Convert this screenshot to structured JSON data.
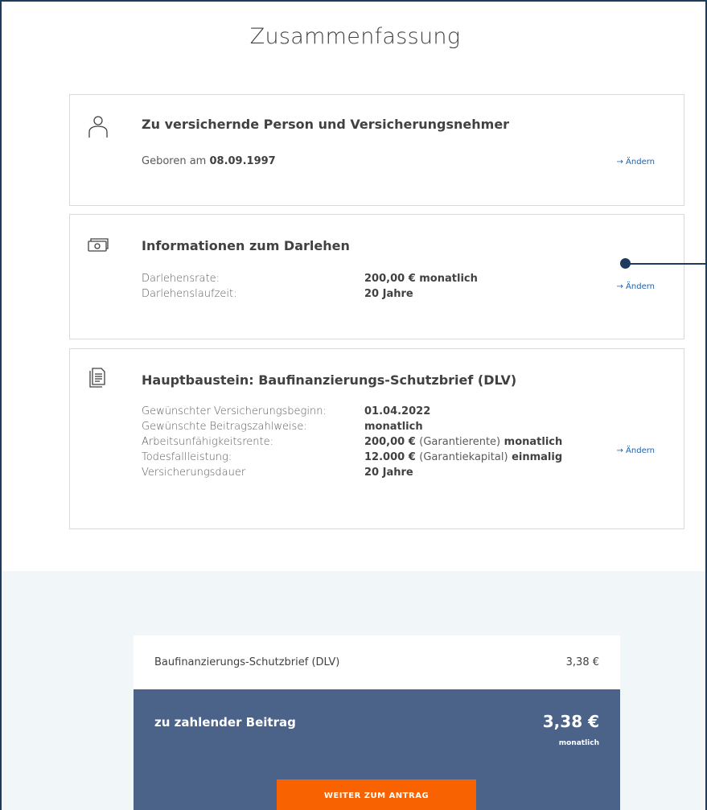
{
  "page": {
    "title": "Zusammenfassung"
  },
  "cards": {
    "person": {
      "icon": "person-icon",
      "title": "Zu versichernde Person und Versicherungsnehmer",
      "birth_label": "Geboren am",
      "birth_value": "08.09.1997",
      "edit_label": "→ Ändern"
    },
    "loan": {
      "icon": "money-icon",
      "title": "Informationen zum Darlehen",
      "rows": [
        {
          "label": "Darlehensrate:",
          "value": "200,00 € monatlich"
        },
        {
          "label": "Darlehenslaufzeit:",
          "value": "20 Jahre"
        }
      ],
      "edit_label": "→ Ändern"
    },
    "main": {
      "icon": "document-icon",
      "title": "Hauptbaustein: Baufinanzierungs-Schutzbrief (DLV)",
      "rows": [
        {
          "label": "Gewünschter Versicherungsbeginn:",
          "value": "01.04.2022"
        },
        {
          "label": "Gewünschte Beitragszahlweise:",
          "value": "monatlich"
        },
        {
          "label": "Arbeitsunfähigkeitsrente:",
          "value_a": "200,00 €",
          "value_b": "(Garantierente)",
          "value_c": "monatlich"
        },
        {
          "label": "Todesfallleistung:",
          "value_a": "12.000 €",
          "value_b": "(Garantiekapital)",
          "value_c": "einmalig"
        },
        {
          "label": "Versicherungsdauer",
          "value": "20 Jahre"
        }
      ],
      "edit_label": "→ Ändern"
    }
  },
  "summary": {
    "product_label": "Baufinanzierungs-Schutzbrief (DLV)",
    "product_price": "3,38 €",
    "total_label": "zu zahlender Beitrag",
    "total_amount": "3,38 €",
    "total_period": "monatlich",
    "cta_label": "WEITER ZUM ANTRAG"
  },
  "colors": {
    "accent": "#f86200",
    "panel": "#4c6389",
    "link": "#1f5fa8",
    "band": "#f1f7f9"
  }
}
